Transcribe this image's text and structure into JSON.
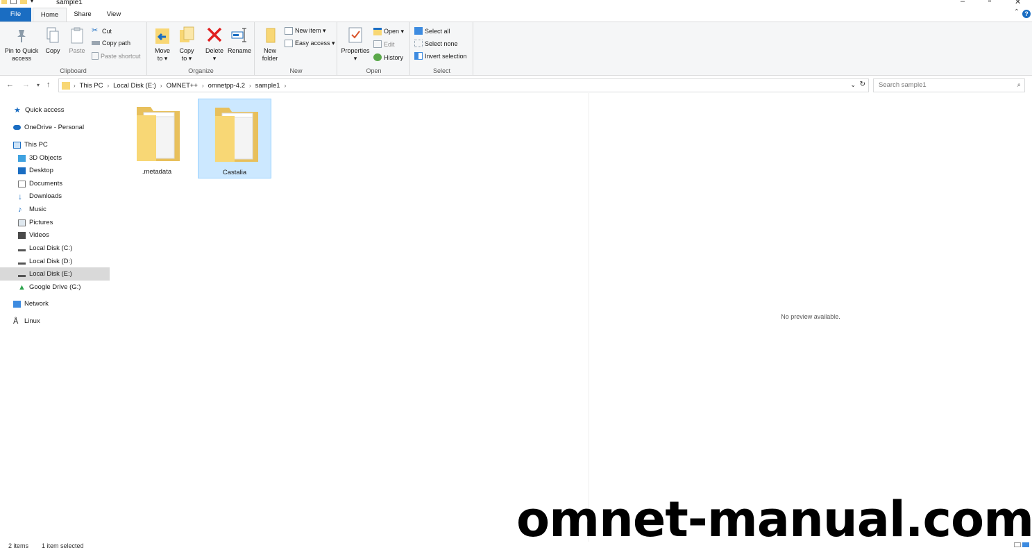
{
  "window": {
    "title": "sample1"
  },
  "tabs": {
    "file": "File",
    "home": "Home",
    "share": "Share",
    "view": "View"
  },
  "ribbon": {
    "clipboard": {
      "label": "Clipboard",
      "pin_l1": "Pin to Quick",
      "pin_l2": "access",
      "copy": "Copy",
      "paste": "Paste",
      "cut": "Cut",
      "copy_path": "Copy path",
      "paste_shortcut": "Paste shortcut"
    },
    "organize": {
      "label": "Organize",
      "move_l1": "Move",
      "move_l2": "to ▾",
      "copy_l1": "Copy",
      "copy_l2": "to ▾",
      "delete_l1": "Delete",
      "delete_l2": "▾",
      "rename": "Rename"
    },
    "new": {
      "label": "New",
      "folder_l1": "New",
      "folder_l2": "folder",
      "new_item": "New item ▾",
      "easy_access": "Easy access ▾"
    },
    "open": {
      "label": "Open",
      "properties_l1": "Properties",
      "properties_l2": "▾",
      "open": "Open ▾",
      "edit": "Edit",
      "history": "History"
    },
    "select": {
      "label": "Select",
      "select_all": "Select all",
      "select_none": "Select none",
      "invert": "Invert selection"
    }
  },
  "address": {
    "crumbs": [
      "This PC",
      "Local Disk (E:)",
      "OMNET++",
      "omnetpp-4.2",
      "sample1"
    ],
    "search_placeholder": "Search sample1"
  },
  "nav": {
    "quick_access": "Quick access",
    "onedrive": "OneDrive - Personal",
    "this_pc": "This PC",
    "objects3d": "3D Objects",
    "desktop": "Desktop",
    "documents": "Documents",
    "downloads": "Downloads",
    "music": "Music",
    "pictures": "Pictures",
    "videos": "Videos",
    "disk_c": "Local Disk (C:)",
    "disk_d": "Local Disk (D:)",
    "disk_e": "Local Disk (E:)",
    "gdrive": "Google Drive (G:)",
    "network": "Network",
    "linux": "Linux"
  },
  "items": [
    {
      "name": ".metadata",
      "selected": false
    },
    {
      "name": "Castalia",
      "selected": true
    }
  ],
  "preview": {
    "text": "No preview available."
  },
  "status": {
    "count": "2 items",
    "selected": "1 item selected"
  },
  "watermark": "omnet-manual.com",
  "colors": {
    "accent": "#1a6dc2",
    "selection": "#cce8ff",
    "folder": "#f8d775"
  }
}
